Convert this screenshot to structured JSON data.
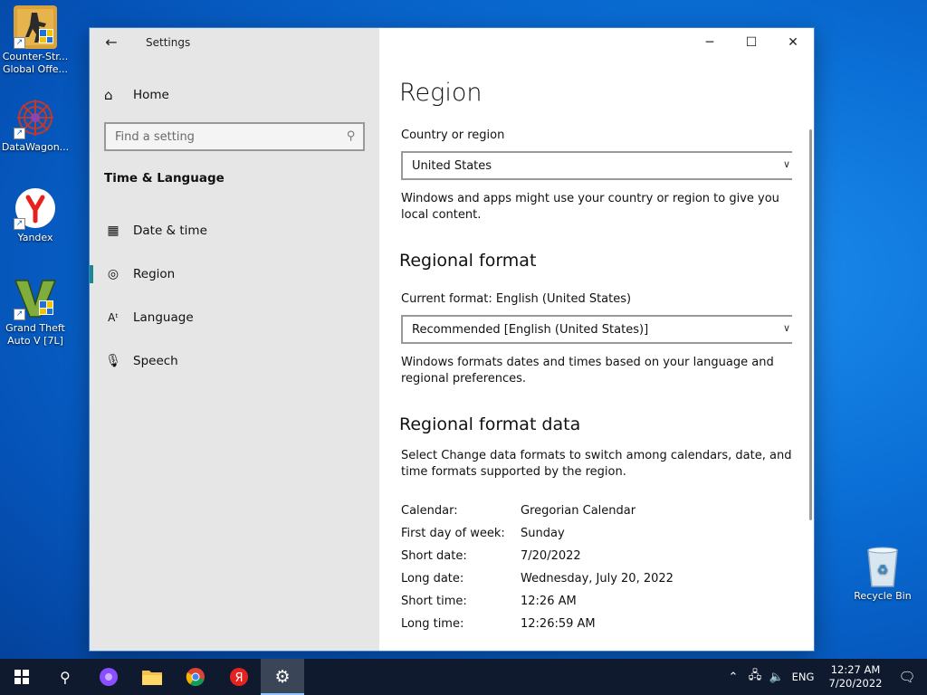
{
  "desktop": {
    "icons": [
      {
        "label": "Counter-Str... Global Offe...",
        "icon": "csgo-icon"
      },
      {
        "label": "DataWagon...",
        "icon": "datawagon-icon"
      },
      {
        "label": "Yandex",
        "icon": "yandex-browser-icon"
      },
      {
        "label": "Grand Theft Auto V [7L]",
        "icon": "gta5-icon"
      },
      {
        "label": "Recycle Bin",
        "icon": "recycle-bin-icon"
      }
    ]
  },
  "window": {
    "title": "Settings",
    "caption": {
      "minimize": "─",
      "maximize": "☐",
      "close": "✕"
    }
  },
  "nav": {
    "home": "Home",
    "search_placeholder": "Find a setting",
    "section": "Time & Language",
    "items": [
      {
        "label": "Date & time",
        "icon": "date-time-icon"
      },
      {
        "label": "Region",
        "icon": "region-icon",
        "selected": true
      },
      {
        "label": "Language",
        "icon": "language-icon"
      },
      {
        "label": "Speech",
        "icon": "microphone-icon"
      }
    ]
  },
  "content": {
    "title": "Region",
    "country_label": "Country or region",
    "country_value": "United States",
    "country_desc": "Windows and apps might use your country or region to give you local content.",
    "regional_format_heading": "Regional format",
    "current_format_label": "Current format: English (United States)",
    "format_value": "Recommended [English (United States)]",
    "format_desc": "Windows formats dates and times based on your language and regional preferences.",
    "format_data_heading": "Regional format data",
    "format_data_desc": "Select Change data formats to switch among calendars, date, and time formats supported by the region.",
    "format_data": [
      {
        "key": "Calendar:",
        "value": "Gregorian Calendar"
      },
      {
        "key": "First day of week:",
        "value": "Sunday"
      },
      {
        "key": "Short date:",
        "value": "7/20/2022"
      },
      {
        "key": "Long date:",
        "value": "Wednesday, July 20, 2022"
      },
      {
        "key": "Short time:",
        "value": "12:26 AM"
      },
      {
        "key": "Long time:",
        "value": "12:26:59 AM"
      }
    ]
  },
  "taskbar": {
    "apps": [
      "start",
      "search",
      "alice",
      "file-explorer",
      "chrome",
      "yandex",
      "settings"
    ],
    "language": "ENG",
    "time": "12:27 AM",
    "date": "7/20/2022"
  }
}
